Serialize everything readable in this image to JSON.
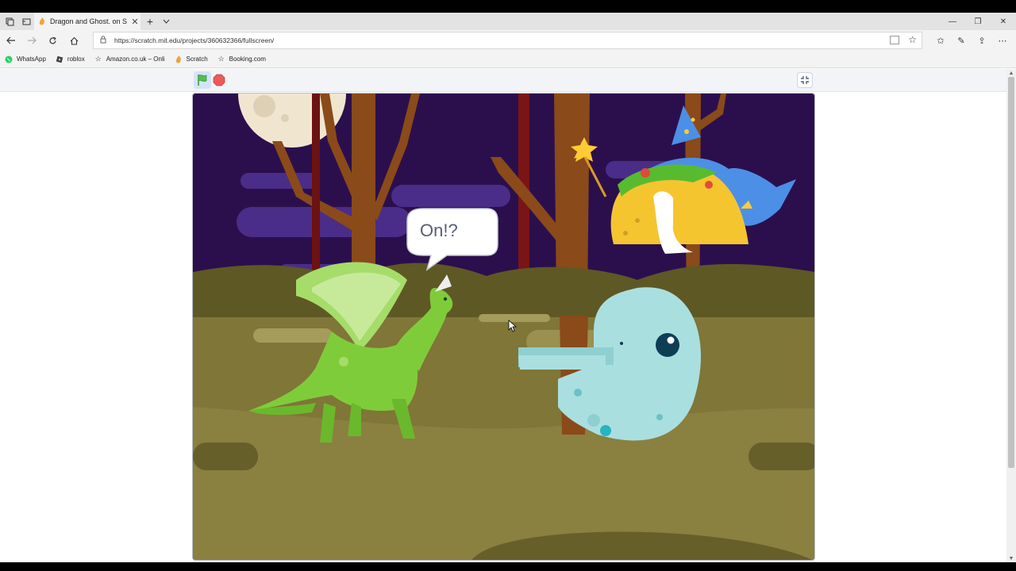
{
  "browser": {
    "tab": {
      "title": "Dragon and Ghost. on S",
      "close_symbol": "✕"
    },
    "new_tab_symbol": "+",
    "url": "https://scratch.mit.edu/projects/360632366/fullscreen/",
    "window_controls": {
      "minimize": "—",
      "restore": "❐",
      "close": "✕"
    }
  },
  "favorites": [
    {
      "label": "WhatsApp",
      "icon": "whatsapp-icon"
    },
    {
      "label": "roblox",
      "icon": "roblox-icon"
    },
    {
      "label": "Amazon.co.uk – Onli",
      "icon": "star-icon"
    },
    {
      "label": "Scratch",
      "icon": "scratch-icon"
    },
    {
      "label": "Booking.com",
      "icon": "star-icon"
    }
  ],
  "stage": {
    "speech_bubble": "On!?"
  },
  "colors": {
    "sky": "#2b0f4d",
    "ground": "#7f7638",
    "dragon": "#7fcc3a",
    "ghost": "#aadfe0",
    "moon": "#f0e6d0",
    "flag": "#4cbf56",
    "stop": "#ec5959"
  }
}
